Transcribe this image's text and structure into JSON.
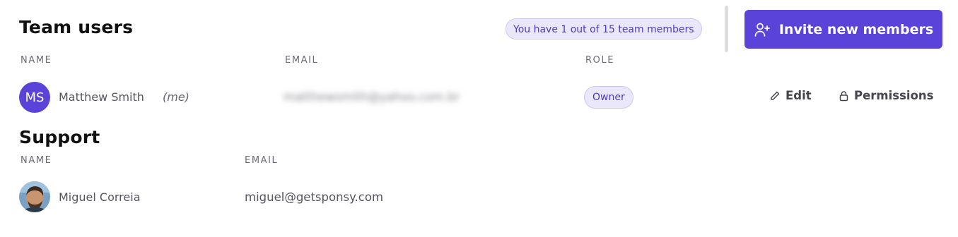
{
  "team_section": {
    "title": "Team users",
    "member_count_badge": "You have 1 out of 15 team members",
    "invite_button_label": "Invite new members",
    "columns": {
      "name": "NAME",
      "email": "EMAIL",
      "role": "ROLE"
    },
    "rows": [
      {
        "initials": "MS",
        "name": "Matthew Smith",
        "me_tag": "(me)",
        "email": "matthewsmith@yahoo.com.br",
        "role": "Owner",
        "edit_label": "Edit",
        "permissions_label": "Permissions"
      }
    ]
  },
  "support_section": {
    "title": "Support",
    "columns": {
      "name": "NAME",
      "email": "EMAIL"
    },
    "rows": [
      {
        "name": "Miguel Correia",
        "email": "miguel@getsponsy.com"
      }
    ]
  },
  "colors": {
    "accent": "#5a43d9",
    "badge_bg": "#ebe7fb",
    "badge_text": "#4b3bbf"
  },
  "icons": {
    "invite": "user-plus-icon",
    "edit": "pencil-icon",
    "permissions": "lock-icon"
  }
}
